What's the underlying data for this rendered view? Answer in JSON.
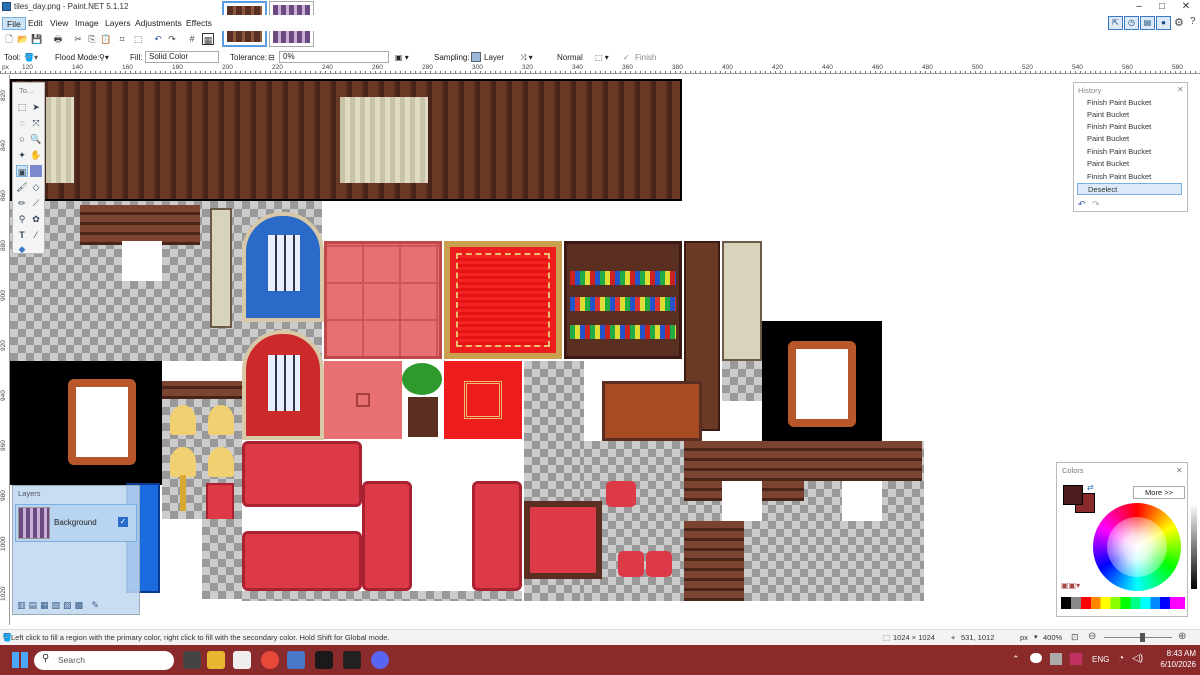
{
  "window": {
    "title": "tiles_day.png - Paint.NET 5.1.12",
    "minimize": "–",
    "maximize": "□",
    "close": "✕"
  },
  "menu": [
    "File",
    "Edit",
    "View",
    "Image",
    "Layers",
    "Adjustments",
    "Effects"
  ],
  "toolbar": {
    "tool_label": "Tool:",
    "flood_mode_label": "Flood Mode:",
    "fill_label": "Fill:",
    "fill_value": "Solid Color",
    "tolerance_label": "Tolerance:",
    "tolerance_value": "0%",
    "sampling_label": "Sampling:",
    "sampling_value": "Layer",
    "blend_value": "Normal",
    "finish_label": "Finish"
  },
  "ruler": {
    "unit": "px",
    "h_ticks": [
      "120",
      "140",
      "160",
      "180",
      "200",
      "220",
      "240",
      "260",
      "280",
      "300",
      "320",
      "340",
      "360",
      "380",
      "400",
      "420",
      "440",
      "460",
      "480",
      "500",
      "520",
      "540",
      "560",
      "580"
    ],
    "v_ticks": [
      "820",
      "840",
      "860",
      "880",
      "900",
      "920",
      "940",
      "960",
      "980",
      "1000",
      "1020"
    ]
  },
  "tools_panel": {
    "title": "To..."
  },
  "history": {
    "title": "History",
    "items": [
      "Finish Paint Bucket",
      "Paint Bucket",
      "Finish Paint Bucket",
      "Paint Bucket",
      "Finish Paint Bucket",
      "Paint Bucket",
      "Finish Paint Bucket",
      "Deselect"
    ],
    "selected_index": 7
  },
  "layers": {
    "title": "Layers",
    "items": [
      {
        "name": "Background",
        "visible": true
      }
    ]
  },
  "colors": {
    "title": "Colors",
    "more_label": "More >>",
    "primary": "#4a1c1c",
    "secondary": "#8b2a2a"
  },
  "status": {
    "hint": "Left click to fill a region with the primary color, right click to fill with the secondary color. Hold Shift for Global mode.",
    "image_size": "1024 × 1024",
    "cursor": "531, 1012",
    "unit": "px",
    "zoom": "400%"
  },
  "taskbar": {
    "search_placeholder": "Search",
    "language": "ENG",
    "time": "8:43 AM",
    "date": "6/10/2026"
  }
}
